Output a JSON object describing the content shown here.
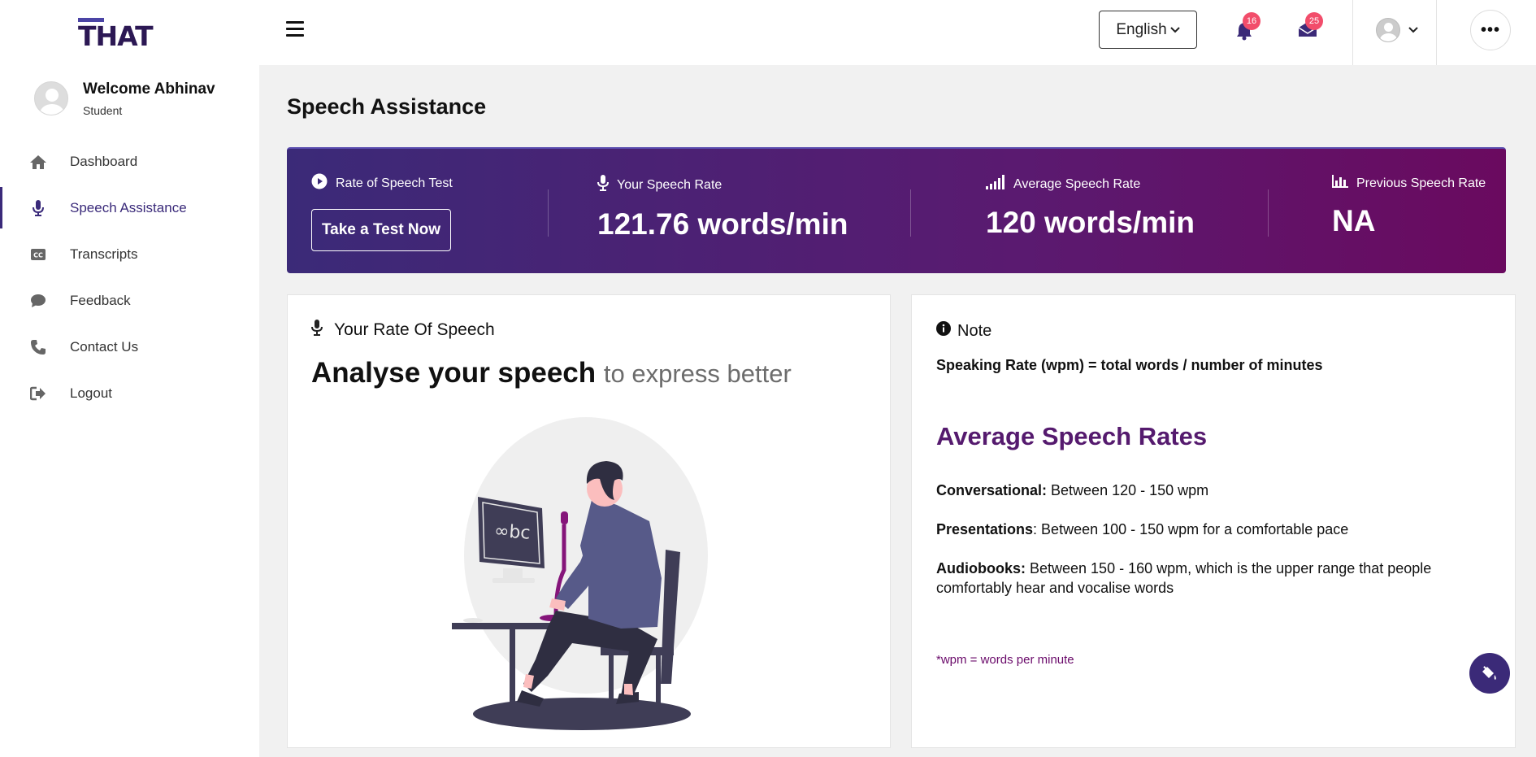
{
  "app": {
    "logo_text": "THAT"
  },
  "user": {
    "welcome": "Welcome Abhinav",
    "role": "Student"
  },
  "sidebar": {
    "items": [
      {
        "label": "Dashboard",
        "icon": "home-icon"
      },
      {
        "label": "Speech Assistance",
        "icon": "microphone-icon",
        "active": true
      },
      {
        "label": "Transcripts",
        "icon": "closed-captions-icon"
      },
      {
        "label": "Feedback",
        "icon": "comment-icon"
      },
      {
        "label": "Contact Us",
        "icon": "phone-icon"
      },
      {
        "label": "Logout",
        "icon": "logout-icon"
      }
    ]
  },
  "header": {
    "language": "English",
    "notifications_count": "16",
    "messages_count": "25"
  },
  "page": {
    "title": "Speech Assistance"
  },
  "banner": {
    "test": {
      "label": "Rate of Speech Test",
      "button": "Take a Test Now"
    },
    "your_rate": {
      "label": "Your Speech Rate",
      "value": "121.76 words/min"
    },
    "average_rate": {
      "label": "Average Speech Rate",
      "value": "120 words/min"
    },
    "previous_rate": {
      "label": "Previous Speech Rate",
      "value": "NA"
    }
  },
  "left_card": {
    "heading": "Your Rate Of Speech",
    "headline_strong": "Analyse your speech",
    "headline_light": "to express better",
    "screen_text": "∞bc"
  },
  "note_card": {
    "heading": "Note",
    "formula": "Speaking Rate (wpm) = total words / number of minutes",
    "title": "Average Speech Rates",
    "rates": [
      {
        "label": "Conversational:",
        "text": " Between 120 - 150 wpm"
      },
      {
        "label": "Presentations",
        "text": ": Between 100 - 150 wpm for a comfortable pace"
      },
      {
        "label": "Audiobooks:",
        "text": " Between 150 - 160 wpm, which is the upper range that people comfortably hear and vocalise words"
      }
    ],
    "footnote": "*wpm = words per minute"
  },
  "colors": {
    "brand_dark": "#2c1854",
    "banner_start": "#3b2a78",
    "banner_end": "#6a0a5f",
    "accent_purple": "#551a6e",
    "badge": "#f24d6b"
  }
}
